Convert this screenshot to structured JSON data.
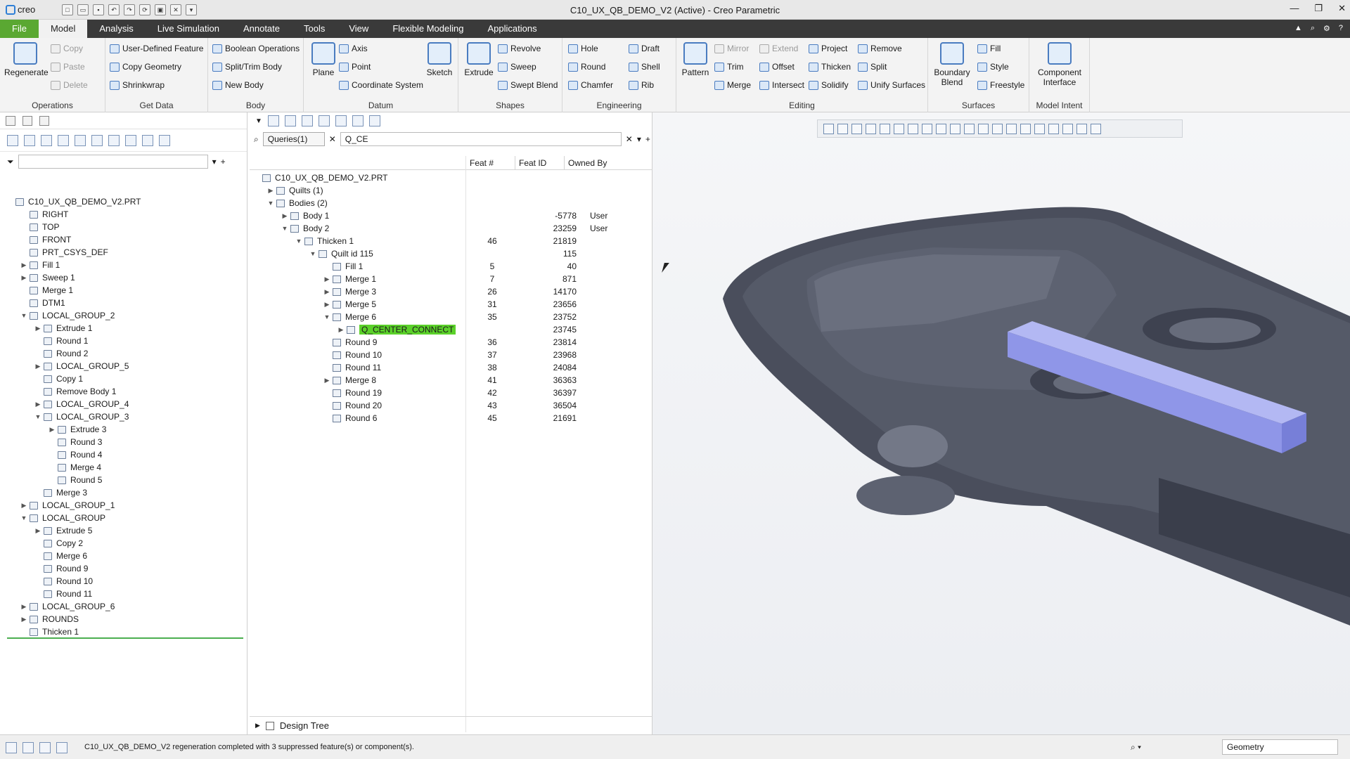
{
  "app": {
    "logo": "creo",
    "title": "C10_UX_QB_DEMO_V2 (Active) - Creo Parametric"
  },
  "menu": {
    "tabs": [
      "File",
      "Model",
      "Analysis",
      "Live Simulation",
      "Annotate",
      "Tools",
      "View",
      "Flexible Modeling",
      "Applications"
    ],
    "active": "Model"
  },
  "ribbon": {
    "operations": {
      "regenerate": "Regenerate",
      "copy": "Copy",
      "paste": "Paste",
      "delete": "Delete",
      "label": "Operations"
    },
    "getdata": {
      "udf": "User-Defined Feature",
      "copygeom": "Copy Geometry",
      "shrinkwrap": "Shrinkwrap",
      "label": "Get Data"
    },
    "body": {
      "boolean": "Boolean Operations",
      "split": "Split/Trim Body",
      "newbody": "New Body",
      "label": "Body"
    },
    "datum": {
      "plane": "Plane",
      "axis": "Axis",
      "point": "Point",
      "csys": "Coordinate System",
      "sketch": "Sketch",
      "label": "Datum"
    },
    "shapes": {
      "extrude": "Extrude",
      "revolve": "Revolve",
      "sweep": "Sweep",
      "sweptblend": "Swept Blend",
      "label": "Shapes"
    },
    "engineering": {
      "hole": "Hole",
      "round": "Round",
      "chamfer": "Chamfer",
      "draft": "Draft",
      "shell": "Shell",
      "rib": "Rib",
      "label": "Engineering"
    },
    "editing": {
      "pattern": "Pattern",
      "mirror": "Mirror",
      "trim": "Trim",
      "merge": "Merge",
      "extend": "Extend",
      "offset": "Offset",
      "intersect": "Intersect",
      "project": "Project",
      "thicken": "Thicken",
      "solidify": "Solidify",
      "remove": "Remove",
      "split": "Split",
      "unify": "Unify Surfaces",
      "label": "Editing"
    },
    "surfaces": {
      "boundary": "Boundary Blend",
      "fill": "Fill",
      "style": "Style",
      "freestyle": "Freestyle",
      "label": "Surfaces"
    },
    "modelintent": {
      "component": "Component Interface",
      "label": "Model Intent"
    }
  },
  "left_tree": [
    {
      "t": "C10_UX_QB_DEMO_V2.PRT",
      "d": 0,
      "e": ""
    },
    {
      "t": "RIGHT",
      "d": 1,
      "e": ""
    },
    {
      "t": "TOP",
      "d": 1,
      "e": ""
    },
    {
      "t": "FRONT",
      "d": 1,
      "e": ""
    },
    {
      "t": "PRT_CSYS_DEF",
      "d": 1,
      "e": ""
    },
    {
      "t": "Fill 1",
      "d": 1,
      "e": "▶"
    },
    {
      "t": "Sweep 1",
      "d": 1,
      "e": "▶"
    },
    {
      "t": "Merge 1",
      "d": 1,
      "e": ""
    },
    {
      "t": "DTM1",
      "d": 1,
      "e": ""
    },
    {
      "t": "LOCAL_GROUP_2",
      "d": 1,
      "e": "▼"
    },
    {
      "t": "Extrude 1",
      "d": 2,
      "e": "▶"
    },
    {
      "t": "Round 1",
      "d": 2,
      "e": ""
    },
    {
      "t": "Round 2",
      "d": 2,
      "e": ""
    },
    {
      "t": "LOCAL_GROUP_5",
      "d": 2,
      "e": "▶"
    },
    {
      "t": "Copy 1",
      "d": 2,
      "e": ""
    },
    {
      "t": "Remove Body 1",
      "d": 2,
      "e": ""
    },
    {
      "t": "LOCAL_GROUP_4",
      "d": 2,
      "e": "▶"
    },
    {
      "t": "LOCAL_GROUP_3",
      "d": 2,
      "e": "▼"
    },
    {
      "t": "Extrude 3",
      "d": 3,
      "e": "▶"
    },
    {
      "t": "Round 3",
      "d": 3,
      "e": ""
    },
    {
      "t": "Round 4",
      "d": 3,
      "e": ""
    },
    {
      "t": "Merge 4",
      "d": 3,
      "e": ""
    },
    {
      "t": "Round 5",
      "d": 3,
      "e": ""
    },
    {
      "t": "Merge 3",
      "d": 2,
      "e": ""
    },
    {
      "t": "LOCAL_GROUP_1",
      "d": 1,
      "e": "▶"
    },
    {
      "t": "LOCAL_GROUP",
      "d": 1,
      "e": "▼"
    },
    {
      "t": "Extrude 5",
      "d": 2,
      "e": "▶"
    },
    {
      "t": "Copy 2",
      "d": 2,
      "e": ""
    },
    {
      "t": "Merge 6",
      "d": 2,
      "e": ""
    },
    {
      "t": "Round 9",
      "d": 2,
      "e": ""
    },
    {
      "t": "Round 10",
      "d": 2,
      "e": ""
    },
    {
      "t": "Round 11",
      "d": 2,
      "e": ""
    },
    {
      "t": "LOCAL_GROUP_6",
      "d": 1,
      "e": "▶"
    },
    {
      "t": "ROUNDS",
      "d": 1,
      "e": "▶"
    },
    {
      "t": "Thicken 1",
      "d": 1,
      "e": ""
    }
  ],
  "query": {
    "selector": "Queries(1)",
    "value": "Q_CE"
  },
  "columns": {
    "feat_num": "Feat #",
    "feat_id": "Feat ID",
    "owned_by": "Owned By"
  },
  "mid_tree": [
    {
      "t": "C10_UX_QB_DEMO_V2.PRT",
      "d": 0,
      "e": "",
      "n": "",
      "id": "",
      "o": ""
    },
    {
      "t": "Quilts (1)",
      "d": 1,
      "e": "▶",
      "n": "",
      "id": "",
      "o": ""
    },
    {
      "t": "Bodies (2)",
      "d": 1,
      "e": "▼",
      "n": "",
      "id": "",
      "o": ""
    },
    {
      "t": "Body 1",
      "d": 2,
      "e": "▶",
      "n": "",
      "id": "-5778",
      "o": "User"
    },
    {
      "t": "Body 2",
      "d": 2,
      "e": "▼",
      "n": "",
      "id": "23259",
      "o": "User"
    },
    {
      "t": "Thicken 1",
      "d": 3,
      "e": "▼",
      "n": "46",
      "id": "21819",
      "o": ""
    },
    {
      "t": "Quilt id 115",
      "d": 4,
      "e": "▼",
      "n": "",
      "id": "115",
      "o": ""
    },
    {
      "t": "Fill 1",
      "d": 5,
      "e": "",
      "n": "5",
      "id": "40",
      "o": ""
    },
    {
      "t": "Merge 1",
      "d": 5,
      "e": "▶",
      "n": "7",
      "id": "871",
      "o": ""
    },
    {
      "t": "Merge 3",
      "d": 5,
      "e": "▶",
      "n": "26",
      "id": "14170",
      "o": ""
    },
    {
      "t": "Merge 5",
      "d": 5,
      "e": "▶",
      "n": "31",
      "id": "23656",
      "o": ""
    },
    {
      "t": "Merge 6",
      "d": 5,
      "e": "▼",
      "n": "35",
      "id": "23752",
      "o": ""
    },
    {
      "t": "Q_CENTER_CONNECT",
      "d": 6,
      "e": "▶",
      "n": "",
      "id": "23745",
      "o": "",
      "hl": true
    },
    {
      "t": "Round 9",
      "d": 5,
      "e": "",
      "n": "36",
      "id": "23814",
      "o": ""
    },
    {
      "t": "Round 10",
      "d": 5,
      "e": "",
      "n": "37",
      "id": "23968",
      "o": ""
    },
    {
      "t": "Round 11",
      "d": 5,
      "e": "",
      "n": "38",
      "id": "24084",
      "o": ""
    },
    {
      "t": "Merge 8",
      "d": 5,
      "e": "▶",
      "n": "41",
      "id": "36363",
      "o": ""
    },
    {
      "t": "Round 19",
      "d": 5,
      "e": "",
      "n": "42",
      "id": "36397",
      "o": ""
    },
    {
      "t": "Round 20",
      "d": 5,
      "e": "",
      "n": "43",
      "id": "36504",
      "o": ""
    },
    {
      "t": "Round 6",
      "d": 5,
      "e": "",
      "n": "45",
      "id": "21691",
      "o": ""
    }
  ],
  "design_tree_label": "Design Tree",
  "status": {
    "message": "C10_UX_QB_DEMO_V2 regeneration completed with 3 suppressed feature(s) or component(s).",
    "filter": "Geometry"
  },
  "colors": {
    "file_tab": "#5aa832",
    "highlight": "#5bd12a",
    "model": "#4a4e5c",
    "selected_body": "#8f96e8"
  }
}
